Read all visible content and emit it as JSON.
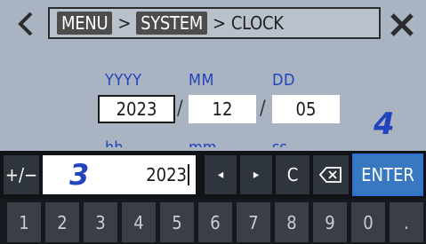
{
  "breadcrumb": {
    "item1": "MENU",
    "sep1": ">",
    "item2": "SYSTEM",
    "sep2": ">",
    "item3": "CLOCK"
  },
  "date": {
    "year_label": "YYYY",
    "month_label": "MM",
    "day_label": "DD",
    "year_value": "2023",
    "month_value": "12",
    "day_value": "05",
    "separator": "/"
  },
  "time": {
    "hour_label": "hh",
    "minute_label": "mm",
    "second_label": "ss"
  },
  "callouts": {
    "step3": "3",
    "step4": "4"
  },
  "entry": {
    "sign_label": "+/−",
    "value": "2023",
    "left_arrow": "◂",
    "right_arrow": "▸",
    "clear_label": "C",
    "enter_label": "ENTER"
  },
  "numpad": [
    "1",
    "2",
    "3",
    "4",
    "5",
    "6",
    "7",
    "8",
    "9",
    "0",
    "."
  ],
  "icons": {
    "back": "chevron-left-icon",
    "close": "close-icon",
    "backspace": "backspace-icon"
  },
  "colors": {
    "accent": "#2244bb",
    "enter": "#3878c0",
    "background": "#a9b3c2"
  }
}
